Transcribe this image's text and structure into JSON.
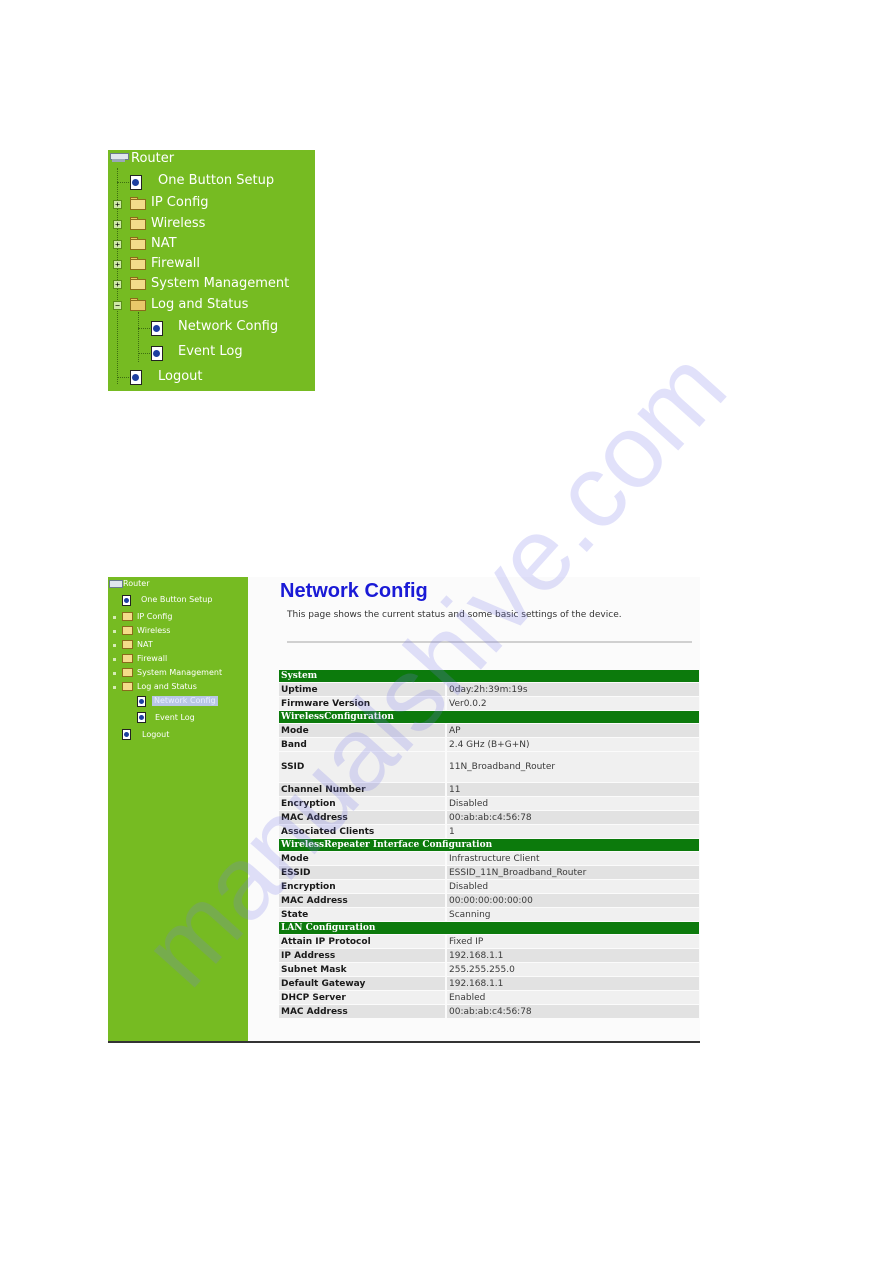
{
  "top_menu": {
    "root": "Router",
    "items": [
      {
        "label": "One Button Setup",
        "type": "page"
      },
      {
        "label": "IP Config",
        "type": "folder",
        "expanded": false
      },
      {
        "label": "Wireless",
        "type": "folder",
        "expanded": false
      },
      {
        "label": "NAT",
        "type": "folder",
        "expanded": false
      },
      {
        "label": "Firewall",
        "type": "folder",
        "expanded": false
      },
      {
        "label": "System Management",
        "type": "folder",
        "expanded": false
      },
      {
        "label": "Log and Status",
        "type": "folder",
        "expanded": true,
        "children": [
          {
            "label": "Network Config",
            "type": "page"
          },
          {
            "label": "Event Log",
            "type": "page"
          }
        ]
      },
      {
        "label": "Logout",
        "type": "page"
      }
    ]
  },
  "screenshot": {
    "sidebar": {
      "root": "Router",
      "items": [
        {
          "label": "One Button Setup"
        },
        {
          "label": "IP Config"
        },
        {
          "label": "Wireless"
        },
        {
          "label": "NAT"
        },
        {
          "label": "Firewall"
        },
        {
          "label": "System Management"
        },
        {
          "label": "Log and Status"
        },
        {
          "label": "Network Config",
          "selected": true
        },
        {
          "label": "Event Log"
        },
        {
          "label": "Logout"
        }
      ]
    },
    "page_title": "Network Config",
    "description": "This page shows the current status and some basic settings of the device.",
    "sections": [
      {
        "title": "System",
        "rows": [
          {
            "key": "Uptime",
            "value": "0day:2h:39m:19s"
          },
          {
            "key": "Firmware Version",
            "value": "Ver0.0.2"
          }
        ]
      },
      {
        "title": "WirelessConfiguration",
        "rows": [
          {
            "key": "Mode",
            "value": "AP"
          },
          {
            "key": "Band",
            "value": "2.4 GHz (B+G+N)"
          },
          {
            "key": "SSID",
            "value": "11N_Broadband_Router"
          },
          {
            "key": "Channel Number",
            "value": "11"
          },
          {
            "key": "Encryption",
            "value": "Disabled"
          },
          {
            "key": "MAC Address",
            "value": "00:ab:ab:c4:56:78"
          },
          {
            "key": "Associated Clients",
            "value": "1"
          }
        ]
      },
      {
        "title": "WirelessRepeater Interface Configuration",
        "rows": [
          {
            "key": "Mode",
            "value": "Infrastructure Client"
          },
          {
            "key": "ESSID",
            "value": "ESSID_11N_Broadband_Router"
          },
          {
            "key": "Encryption",
            "value": "Disabled"
          },
          {
            "key": "MAC Address",
            "value": "00:00:00:00:00:00"
          },
          {
            "key": "State",
            "value": "Scanning"
          }
        ]
      },
      {
        "title": "LAN Configuration",
        "rows": [
          {
            "key": "Attain IP Protocol",
            "value": "Fixed IP"
          },
          {
            "key": "IP Address",
            "value": "192.168.1.1"
          },
          {
            "key": "Subnet Mask",
            "value": "255.255.255.0"
          },
          {
            "key": "Default Gateway",
            "value": "192.168.1.1"
          },
          {
            "key": "DHCP Server",
            "value": "Enabled"
          },
          {
            "key": "MAC Address",
            "value": "00:ab:ab:c4:56:78"
          }
        ]
      }
    ]
  },
  "watermark": "manualshive.com",
  "colors": {
    "menu_green": "#76bb22",
    "header_green": "#0c7a0c",
    "title_blue": "#1a1ad6"
  }
}
